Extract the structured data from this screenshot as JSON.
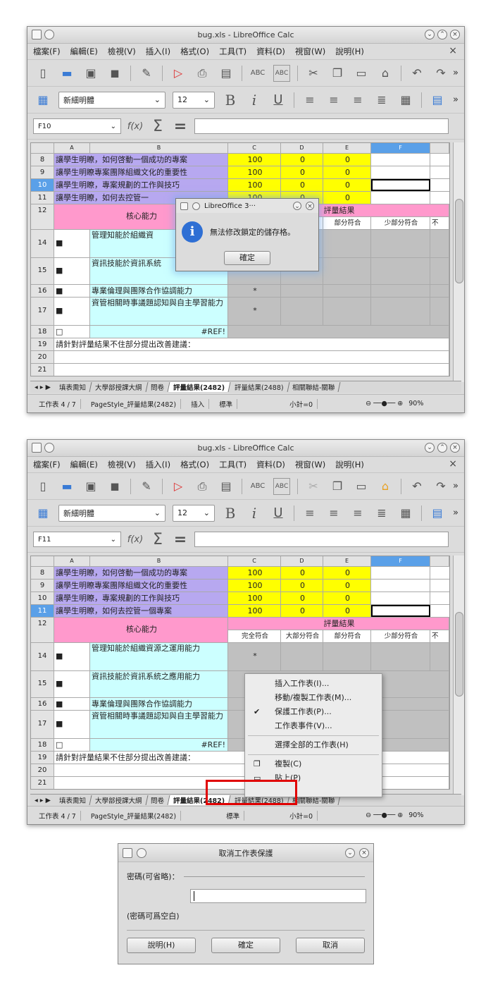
{
  "window": {
    "title": "bug.xls - LibreOffice Calc"
  },
  "menu": [
    "檔案(F)",
    "編輯(E)",
    "檢視(V)",
    "插入(I)",
    "格式(O)",
    "工具(T)",
    "資料(D)",
    "視窗(W)",
    "說明(H)"
  ],
  "font": {
    "name": "新細明體",
    "size": "12"
  },
  "namebox1": "F10",
  "namebox2": "F11",
  "columns": [
    "A",
    "B",
    "C",
    "D",
    "E",
    "F"
  ],
  "rows": {
    "r8": {
      "num": "8",
      "label": "讓學生明瞭，如何啓動一個成功的專案",
      "c": "100",
      "d": "0",
      "e": "0"
    },
    "r9": {
      "num": "9",
      "label": "讓學生明瞭專案團隊組織文化的重要性",
      "c": "100",
      "d": "0",
      "e": "0"
    },
    "r10": {
      "num": "10",
      "label": "讓學生明瞭，專案規劃的工作與技巧",
      "c": "100",
      "d": "0",
      "e": "0"
    },
    "r11": {
      "num": "11",
      "label": "讓學生明瞭，如何去控管一個專案",
      "label_short": "讓學生明瞭，如何去控管一",
      "c": "100",
      "d": "0",
      "e": "0"
    },
    "r12": {
      "num": "12",
      "core": "核心能力",
      "eval": "評量結果"
    },
    "r13": {
      "num": "13",
      "h1": "完全符合",
      "h2": "大部分符合",
      "h3": "部分符合",
      "h4": "少部分符合",
      "h5": "不"
    },
    "r14": {
      "num": "14",
      "text": "管理知能於組織資源之運用能力",
      "text_short": "管理知能於組織資",
      "star": "*"
    },
    "r15": {
      "num": "15",
      "text": "資訊技能於資訊系統之應用能力",
      "text_short": "資訊技能於資訊系統",
      "star": "*"
    },
    "r16": {
      "num": "16",
      "text": "專業倫理與團隊合作協調能力",
      "star": "*"
    },
    "r17": {
      "num": "17",
      "text": "資管相關時事議題認知與自主學習能力",
      "star": "*"
    },
    "r18": {
      "num": "18",
      "ref": "#REF!"
    },
    "r19": {
      "num": "19",
      "text": "請針對評量結果不住部分提出改善建議："
    },
    "r20": {
      "num": "20"
    },
    "r21": {
      "num": "21"
    }
  },
  "tabs": [
    "填表需知",
    "大學部授課大綱",
    "問卷",
    "評量結果(2482)",
    "評量結果(2488)",
    "相關聯結-關聯"
  ],
  "tabs2": [
    "填表需知",
    "大學部授課大綱",
    "問卷",
    "評量結果(2482)",
    "評量結果(2488)",
    "相關聯結-關聯"
  ],
  "status": {
    "sheet": "工作表 4 / 7",
    "style": "PageStyle_評量結果(2482)",
    "insert": "插入",
    "std": "標準",
    "sum": "小計=0",
    "zoom": "90%"
  },
  "msgbox": {
    "title": "LibreOffice 3···",
    "message": "無法修改鎖定的儲存格。",
    "ok": "確定"
  },
  "context": {
    "items": [
      "插入工作表(I)...",
      "移動/複製工作表(M)...",
      "保護工作表(P)...",
      "工作表事件(V)...",
      "選擇全部的工作表(H)",
      "複製(C)",
      "貼上(P)"
    ]
  },
  "unprotect": {
    "title": "取消工作表保護",
    "label": "密碼(可省略)：",
    "note": "(密碼可爲空白)",
    "help": "說明(H)",
    "ok": "確定",
    "cancel": "取消"
  }
}
